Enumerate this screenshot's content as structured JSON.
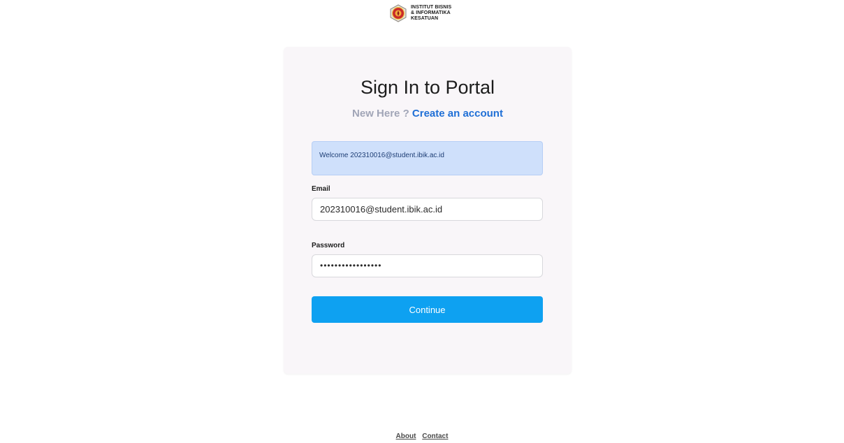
{
  "brand": {
    "logo_lines": [
      "INSTITUT BISNIS",
      "& INFORMATIKA",
      "KESATUAN"
    ],
    "seal_icon": "institution-seal-icon"
  },
  "login": {
    "title": "Sign In to Portal",
    "new_here": "New Here ?",
    "create_account": "Create an account",
    "alert": "Welcome 202310016@student.ibik.ac.id",
    "email_label": "Email",
    "email_value": "202310016@student.ibik.ac.id",
    "password_label": "Password",
    "password_value": "•••••••••••••••••",
    "continue_label": "Continue"
  },
  "footer": {
    "about": "About",
    "contact": "Contact"
  },
  "colors": {
    "primary_button": "#0ea1f1",
    "link": "#1f6fd6",
    "muted": "#a1a5b7",
    "alert_bg": "#cfe0fb",
    "card_bg": "#f9f6f9"
  }
}
